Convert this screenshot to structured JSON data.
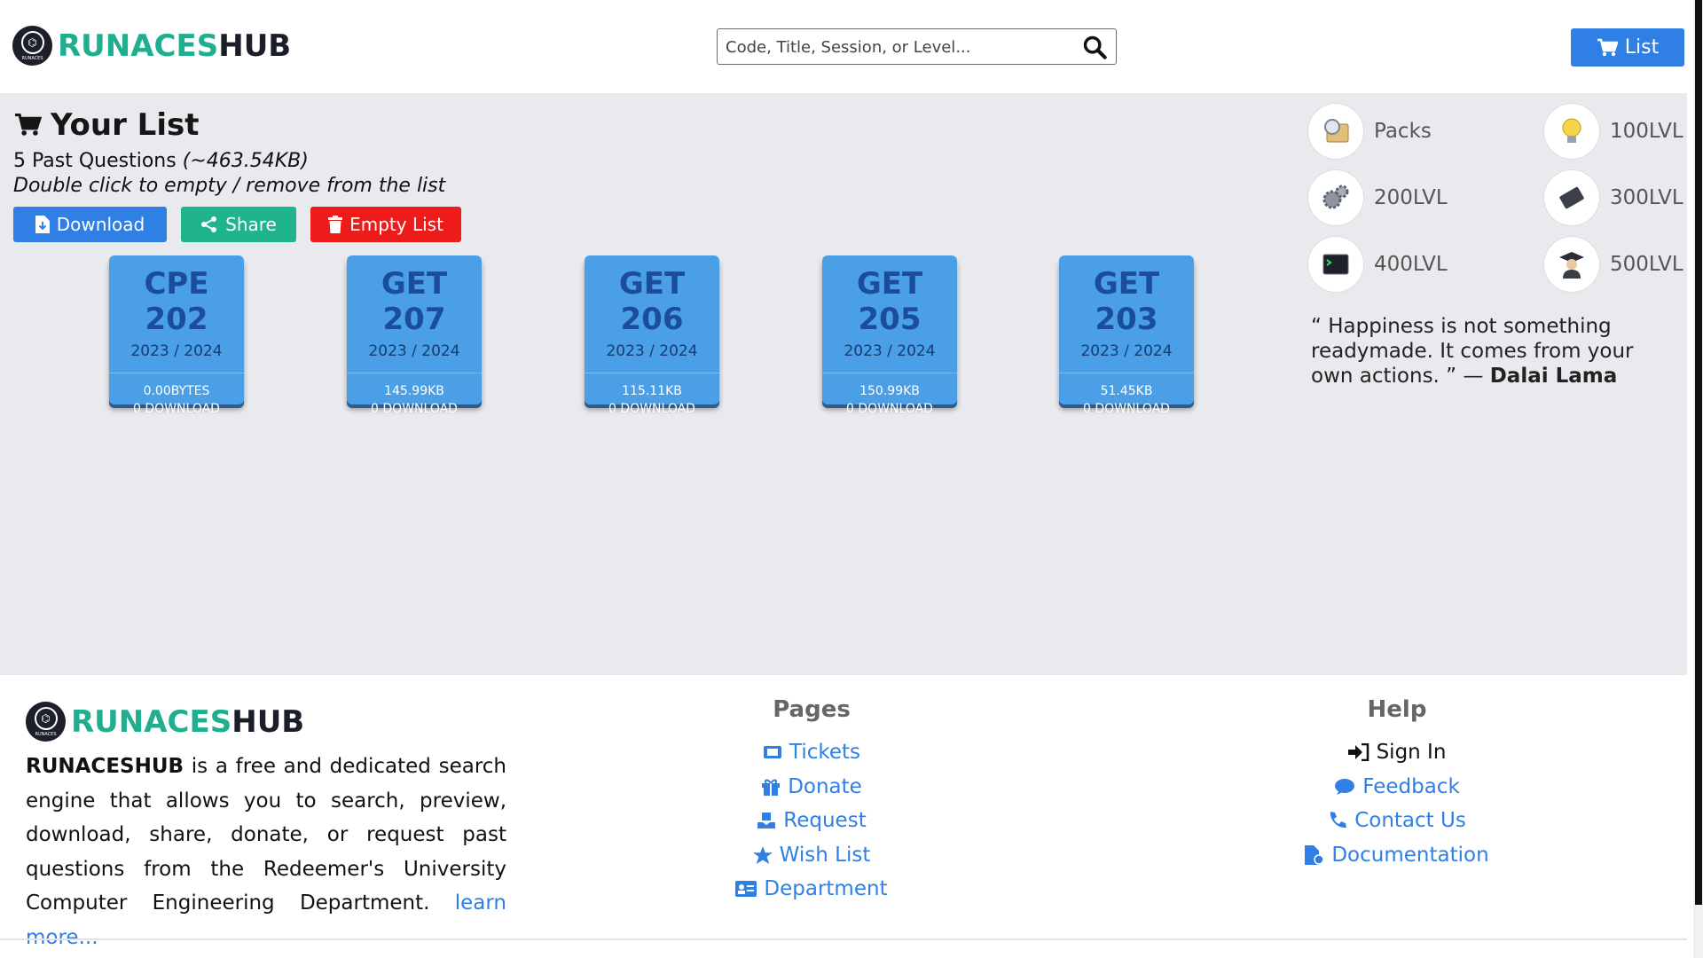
{
  "header": {
    "brand": {
      "part1": "RUNACES",
      "part2": "HUB",
      "logo_text": "RUNACES"
    },
    "search": {
      "placeholder": "Code, Title, Session, or Level..."
    },
    "list_button": "List"
  },
  "main": {
    "title": "Your List",
    "count_text": "5 Past Questions",
    "size_text": "(~463.54KB)",
    "hint": "Double click to empty / remove from the list",
    "buttons": {
      "download": "Download",
      "share": "Share",
      "empty": "Empty List"
    },
    "cards": [
      {
        "code": "CPE 202",
        "session": "2023 / 2024",
        "size": "0.00BYTES",
        "downloads": "0 DOWNLOAD"
      },
      {
        "code": "GET 207",
        "session": "2023 / 2024",
        "size": "145.99KB",
        "downloads": "0 DOWNLOAD"
      },
      {
        "code": "GET 206",
        "session": "2023 / 2024",
        "size": "115.11KB",
        "downloads": "0 DOWNLOAD"
      },
      {
        "code": "GET 205",
        "session": "2023 / 2024",
        "size": "150.99KB",
        "downloads": "0 DOWNLOAD"
      },
      {
        "code": "GET 203",
        "session": "2023 / 2024",
        "size": "51.45KB",
        "downloads": "0 DOWNLOAD"
      }
    ],
    "levels": [
      {
        "label": "Packs",
        "icon": "packs-icon"
      },
      {
        "label": "100LVL",
        "icon": "lightbulb-icon"
      },
      {
        "label": "200LVL",
        "icon": "gears-icon"
      },
      {
        "label": "300LVL",
        "icon": "chip-icon"
      },
      {
        "label": "400LVL",
        "icon": "terminal-icon"
      },
      {
        "label": "500LVL",
        "icon": "graduate-icon"
      }
    ],
    "quote": {
      "text": "“ Happiness is not something readymade. It comes from your own actions. ” —",
      "author": "Dalai Lama"
    }
  },
  "footer": {
    "brand": {
      "part1": "RUNACES",
      "part2": "HUB",
      "logo_text": "RUNACES"
    },
    "about": {
      "strong": "RUNACESHUB",
      "text": " is a free and dedicated search engine that allows you to search, preview, download, share, donate, or request past questions from the Redeemer's University Computer Engineering Department. ",
      "link": "learn more..."
    },
    "pages": {
      "title": "Pages",
      "links": [
        "Tickets",
        "Donate",
        "Request",
        "Wish List",
        "Department"
      ]
    },
    "help": {
      "title": "Help",
      "links": [
        "Sign In",
        "Feedback",
        "Contact Us",
        "Documentation"
      ]
    }
  },
  "colors": {
    "brand_green": "#1fae8e",
    "brand_dark": "#1b1e29",
    "primary": "#2f7fe5",
    "share": "#1fb38e",
    "danger": "#ee1b1b",
    "card": "#4a9fe6"
  }
}
